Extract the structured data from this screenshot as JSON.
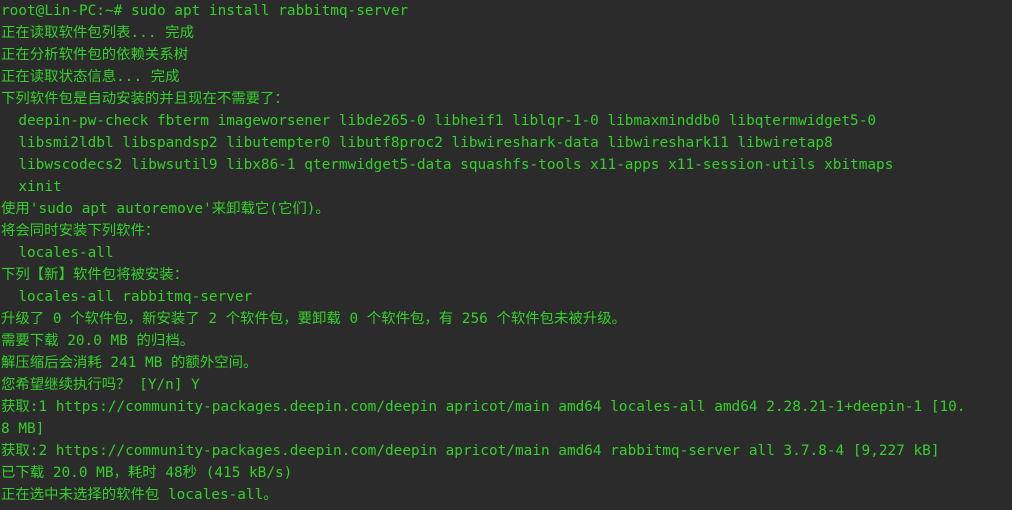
{
  "terminal": {
    "lines": [
      "root@Lin-PC:~# sudo apt install rabbitmq-server",
      "正在读取软件包列表... 完成",
      "正在分析软件包的依赖关系树",
      "正在读取状态信息... 完成",
      "下列软件包是自动安装的并且现在不需要了：",
      "  deepin-pw-check fbterm imageworsener libde265-0 libheif1 liblqr-1-0 libmaxminddb0 libqtermwidget5-0",
      "  libsmi2ldbl libspandsp2 libutempter0 libutf8proc2 libwireshark-data libwireshark11 libwiretap8",
      "  libwscodecs2 libwsutil9 libx86-1 qtermwidget5-data squashfs-tools x11-apps x11-session-utils xbitmaps",
      "  xinit",
      "使用'sudo apt autoremove'来卸载它(它们)。",
      "将会同时安装下列软件：",
      "  locales-all",
      "下列【新】软件包将被安装：",
      "  locales-all rabbitmq-server",
      "升级了 0 个软件包，新安装了 2 个软件包，要卸载 0 个软件包，有 256 个软件包未被升级。",
      "需要下载 20.0 MB 的归档。",
      "解压缩后会消耗 241 MB 的额外空间。",
      "您希望继续执行吗？ [Y/n] Y",
      "获取:1 https://community-packages.deepin.com/deepin apricot/main amd64 locales-all amd64 2.28.21-1+deepin-1 [10.",
      "8 MB]",
      "获取:2 https://community-packages.deepin.com/deepin apricot/main amd64 rabbitmq-server all 3.7.8-4 [9,227 kB]",
      "已下载 20.0 MB，耗时 48秒 (415 kB/s)",
      "正在选中未选择的软件包 locales-all。"
    ],
    "colors": {
      "background": "#2b2b2b",
      "text": "#34d12b"
    }
  }
}
